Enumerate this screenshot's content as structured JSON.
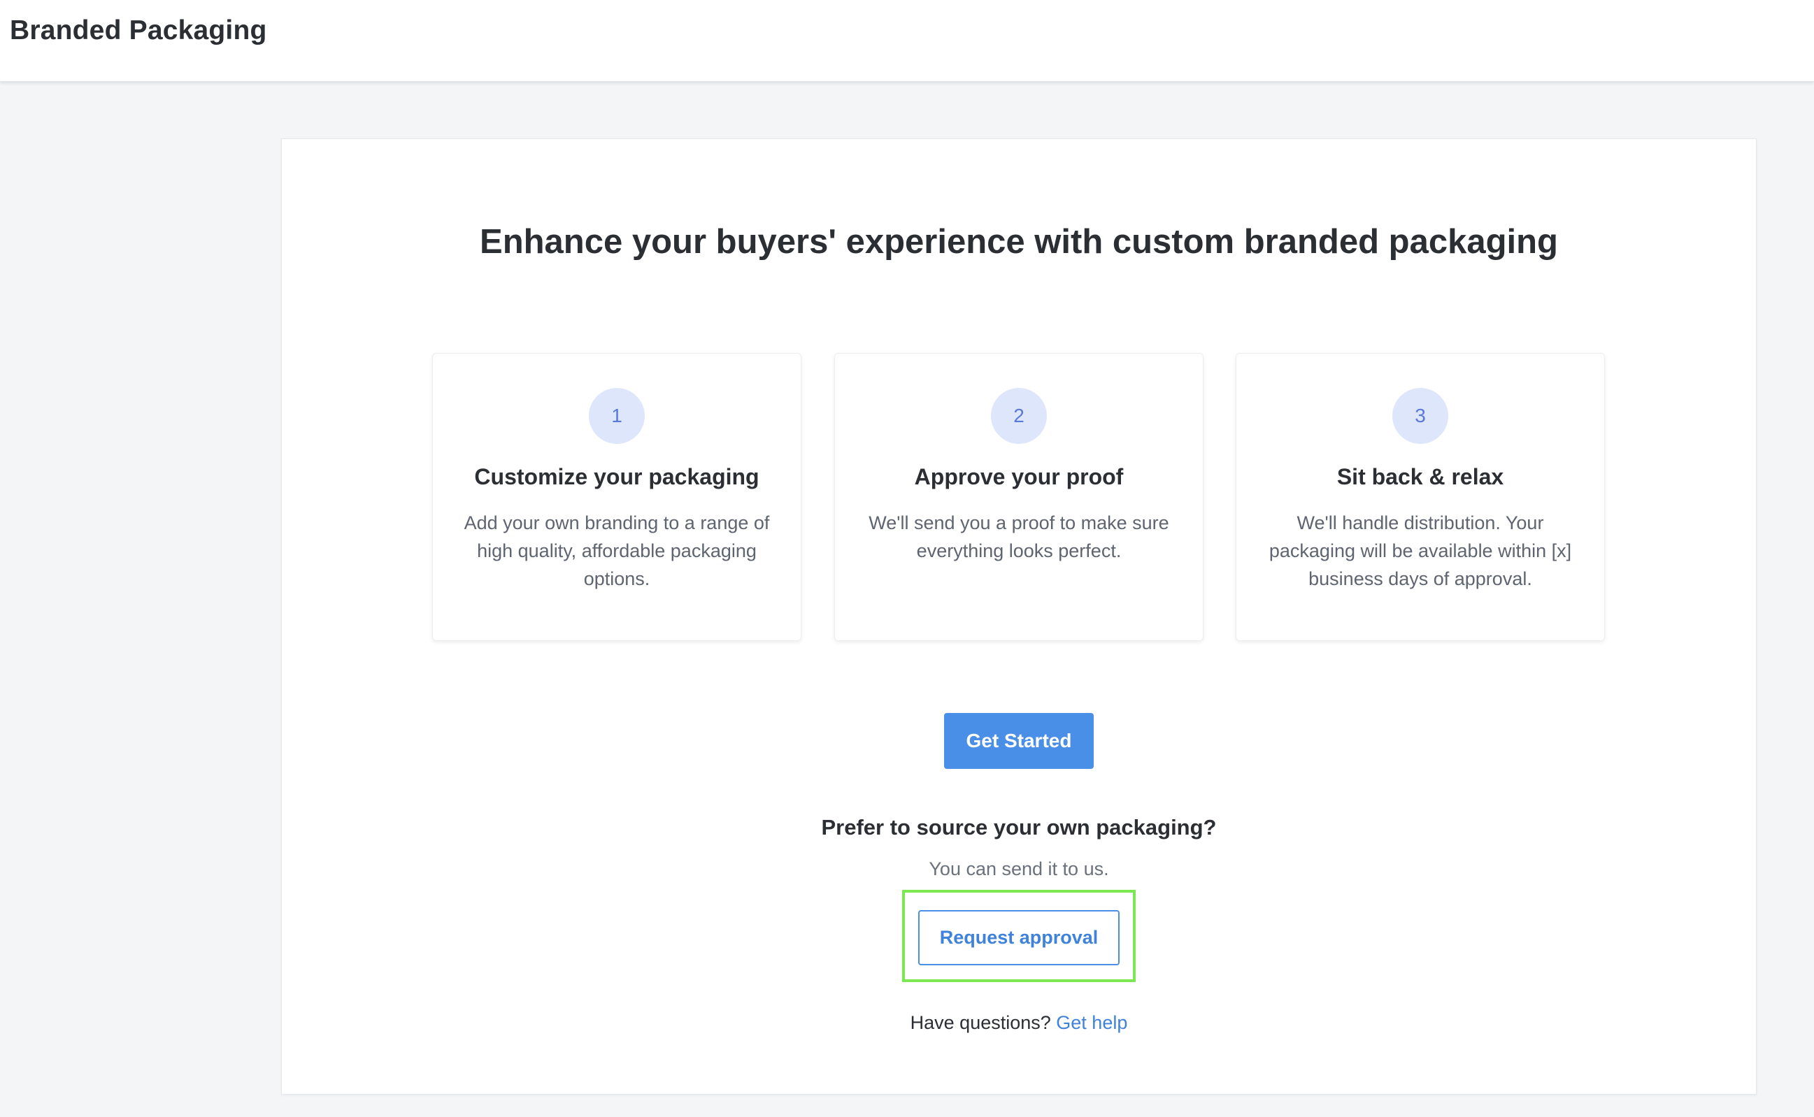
{
  "header": {
    "title": "Branded Packaging"
  },
  "main": {
    "headline": "Enhance your buyers' experience with custom branded packaging",
    "steps": [
      {
        "number": "1",
        "title": "Customize your packaging",
        "description": "Add your own branding to a range of high quality, affordable packaging options."
      },
      {
        "number": "2",
        "title": "Approve your proof",
        "description": "We'll send you a proof to make sure everything looks perfect."
      },
      {
        "number": "3",
        "title": "Sit back & relax",
        "description": "We'll handle distribution. Your packaging will be available within [x] business days of approval."
      }
    ],
    "get_started_label": "Get Started",
    "alt_title": "Prefer to source your own packaging?",
    "alt_subtitle": "You can send it to us.",
    "request_approval_label": "Request approval",
    "help_prefix": "Have questions?",
    "help_link": "Get help"
  },
  "colors": {
    "primary": "#4a8fe7",
    "step_circle_bg": "#dde6fb",
    "step_circle_text": "#5a79d8",
    "highlight": "#7be851",
    "page_bg": "#f4f5f7"
  }
}
